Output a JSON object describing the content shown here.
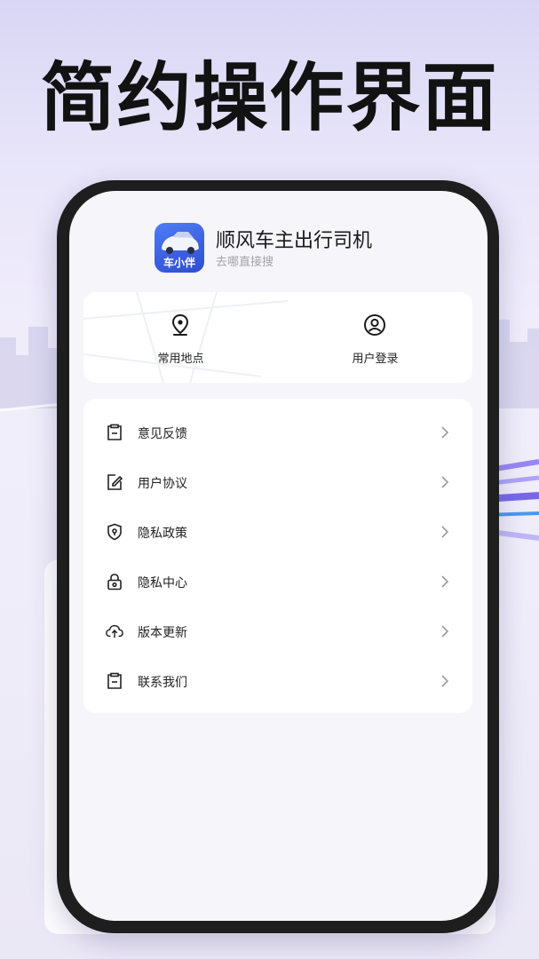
{
  "headline": "简约操作界面",
  "app": {
    "icon_label": "车小伴",
    "title": "顺风车主出行司机",
    "subtitle": "去哪直接搜"
  },
  "quick_actions": [
    {
      "label": "常用地点",
      "icon": "location-pin-icon"
    },
    {
      "label": "用户登录",
      "icon": "user-circle-icon"
    }
  ],
  "menu": [
    {
      "label": "意见反馈",
      "icon": "clipboard-icon"
    },
    {
      "label": "用户协议",
      "icon": "edit-document-icon"
    },
    {
      "label": "隐私政策",
      "icon": "shield-icon"
    },
    {
      "label": "隐私中心",
      "icon": "lock-icon"
    },
    {
      "label": "版本更新",
      "icon": "cloud-upload-icon"
    },
    {
      "label": "联系我们",
      "icon": "clipboard-icon"
    }
  ],
  "colors": {
    "background": "#ece9f8",
    "phone_frame": "#1e1e1f",
    "screen": "#f6f6fa",
    "app_icon": "#3b5ee0",
    "text": "#222222",
    "subtext": "#a3a3a8"
  }
}
